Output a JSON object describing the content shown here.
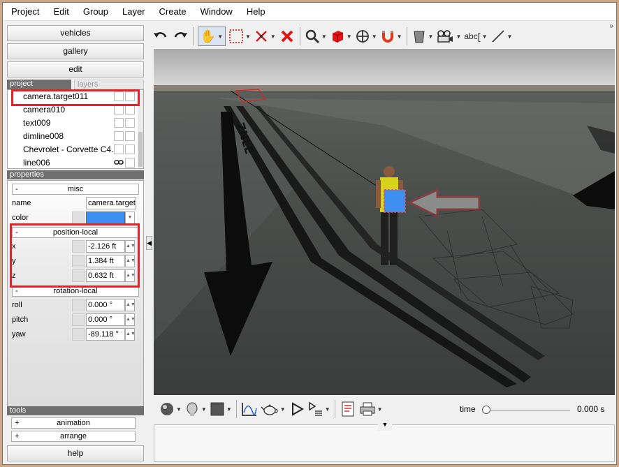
{
  "menu": [
    "Project",
    "Edit",
    "Group",
    "Layer",
    "Create",
    "Window",
    "Help"
  ],
  "nav": {
    "vehicles": "vehicles",
    "gallery": "gallery",
    "edit": "edit",
    "help": "help"
  },
  "tabs": {
    "project": "project",
    "layers": "layers"
  },
  "tree": [
    {
      "label": "camera.target011",
      "linked": false
    },
    {
      "label": "camera010",
      "linked": false
    },
    {
      "label": "text009",
      "linked": false
    },
    {
      "label": "dimline008",
      "linked": false
    },
    {
      "label": "Chevrolet - Corvette C4...",
      "linked": false
    },
    {
      "label": "line006",
      "linked": true
    }
  ],
  "properties": {
    "header": "properties",
    "misc": {
      "title": "misc",
      "name_label": "name",
      "name_value": "camera.target",
      "color_label": "color",
      "color_hex": "#3d8ef0"
    },
    "position": {
      "title": "position-local",
      "x_label": "x",
      "x_value": "-2.126 ft",
      "y_label": "y",
      "y_value": "1.384 ft",
      "z_label": "z",
      "z_value": "0.632 ft"
    },
    "rotation": {
      "title": "rotation-local",
      "roll_label": "roll",
      "roll_value": "0.000 °",
      "pitch_label": "pitch",
      "pitch_value": "0.000 °",
      "yaw_label": "yaw",
      "yaw_value": "-89.118 °"
    },
    "collapse_glyph": "-"
  },
  "tools": {
    "header": "tools",
    "animation": "animation",
    "arrange": "arrange",
    "expand_glyph": "+"
  },
  "toolbar": {
    "text_tool": "abc",
    "overflow": "»"
  },
  "timeline": {
    "time_label": "time",
    "time_value": "0.000 s"
  },
  "colors": {
    "highlight": "#e4222a",
    "selection": "#3d8ef0"
  }
}
